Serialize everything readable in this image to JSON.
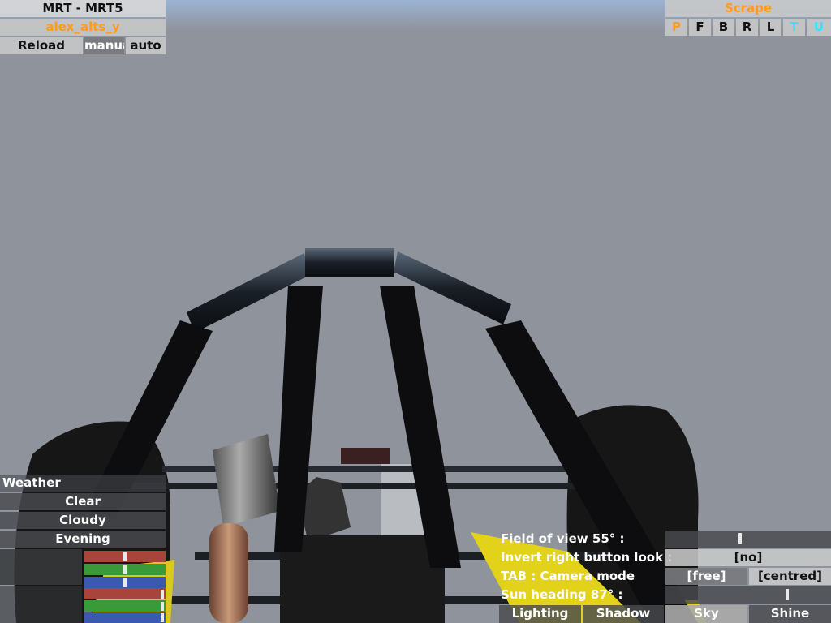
{
  "car": {
    "title": "MRT - MRT5",
    "setup": "alex_alts_y",
    "reload_label": "Reload",
    "manual_label": "manual",
    "auto_label": "auto"
  },
  "view": {
    "title": "Scrape",
    "buttons": [
      "P",
      "F",
      "B",
      "R",
      "L",
      "T",
      "U"
    ]
  },
  "weather": {
    "header": "Weather",
    "options": [
      "Clear",
      "Cloudy",
      "Evening"
    ]
  },
  "options": {
    "fov_label": "Field of view 55° :",
    "fov_value": 0.45,
    "invert_label": "Invert right button look :",
    "invert_value": "[no]",
    "tab_label": "TAB : Camera mode",
    "camera_free": "[free]",
    "camera_centred": "[centred]",
    "sun_label": "Sun heading 87° :",
    "sun_value": 0.74,
    "tabs": [
      "Lighting",
      "Shadow",
      "Sky",
      "Shine"
    ]
  },
  "colors": {
    "sky": "#8f939b",
    "accent_orange": "#ff9a1e",
    "accent_cyan": "#2ee6ff",
    "panel_dark": "#484a4e"
  }
}
